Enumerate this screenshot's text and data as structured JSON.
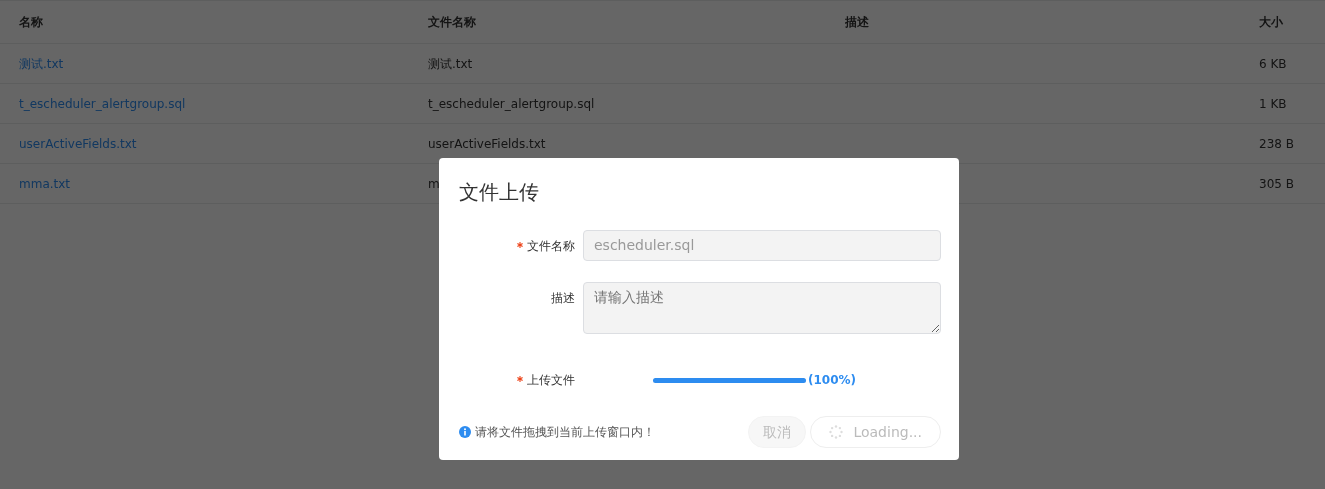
{
  "table": {
    "columns": [
      "名称",
      "文件名称",
      "描述",
      "大小"
    ],
    "rows": [
      {
        "name": "测试.txt",
        "file_name": "测试.txt",
        "size": "6 KB"
      },
      {
        "name": "t_escheduler_alertgroup.sql",
        "file_name": "t_escheduler_alertgroup.sql",
        "size": "1 KB"
      },
      {
        "name": "userActiveFields.txt",
        "file_name": "userActiveFields.txt",
        "size": "238 B"
      },
      {
        "name": "mma.txt",
        "file_name": "m",
        "size": "305 B"
      }
    ]
  },
  "dialog": {
    "title": "文件上传",
    "fields": [
      {
        "label": "文件名称",
        "required": true,
        "kind": "input",
        "value": "escheduler.sql",
        "disabled": true
      },
      {
        "label": "描述",
        "required": false,
        "kind": "textarea",
        "placeholder": "请输入描述",
        "disabled": true
      },
      {
        "label": "上传文件",
        "required": true,
        "kind": "progress",
        "level": 1.0,
        "reading": "(100%)"
      }
    ],
    "hint": "请将文件拖拽到当前上传窗口内！",
    "buttons": [
      {
        "label": "取消",
        "kind": "cancel",
        "disabled": true
      },
      {
        "label": "Loading...",
        "kind": "loading",
        "disabled": true
      }
    ]
  }
}
